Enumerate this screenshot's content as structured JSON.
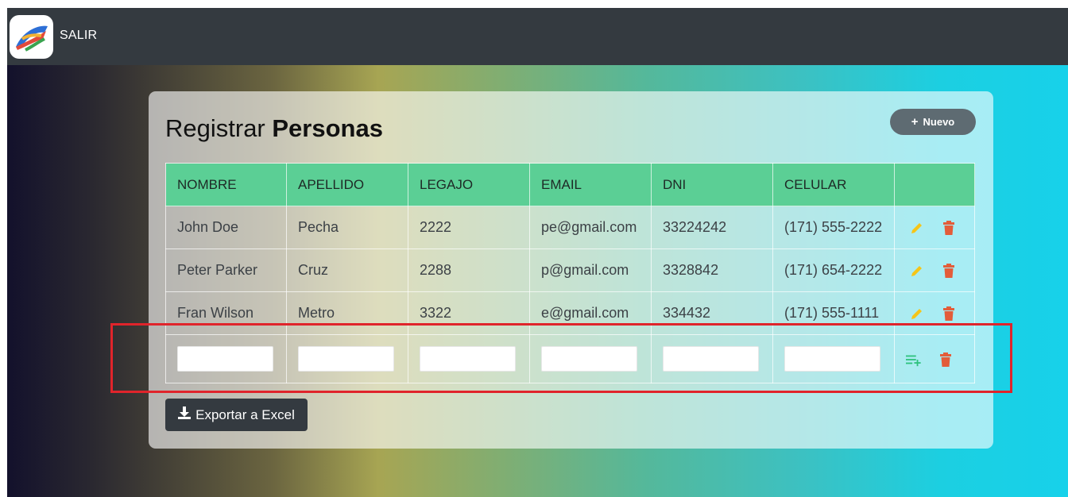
{
  "navbar": {
    "exit_label": "SALIR",
    "logo_icon": "app-logo-icon"
  },
  "page": {
    "title_normal": "Registrar ",
    "title_bold": "Personas"
  },
  "buttons": {
    "new_label": "Nuevo",
    "export_label": "Exportar a Excel"
  },
  "table": {
    "headers": [
      "NOMBRE",
      "APELLIDO",
      "LEGAJO",
      "EMAIL",
      "DNI",
      "CELULAR",
      ""
    ],
    "rows": [
      [
        "John Doe",
        "Pecha",
        "2222",
        "pe@gmail.com",
        "33224242",
        "(171) 555-2222"
      ],
      [
        "Peter Parker",
        "Cruz",
        "2288",
        "p@gmail.com",
        "3328842",
        "(171) 654-2222"
      ],
      [
        "Fran Wilson",
        "Metro",
        "3322",
        "e@gmail.com",
        "334432",
        "(171) 555-1111"
      ]
    ],
    "new_row_values": [
      "",
      "",
      "",
      "",
      "",
      ""
    ]
  },
  "colors": {
    "header_green": "#5bcf95",
    "edit_icon": "#f5c518",
    "delete_icon": "#e35d3a",
    "add_icon": "#2ec27e",
    "highlight": "#e0242b"
  }
}
